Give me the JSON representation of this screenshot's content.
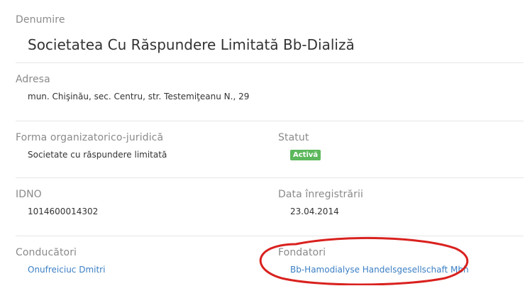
{
  "denumire": {
    "label": "Denumire",
    "value": "Societatea Cu Răspundere Limitată Bb-Dializă"
  },
  "adresa": {
    "label": "Adresa",
    "value": "mun. Chişinău, sec. Centru, str. Testemiţeanu N., 29"
  },
  "forma": {
    "label": "Forma organizatorico-juridică",
    "value": "Societate cu răspundere limitată"
  },
  "statut": {
    "label": "Statut",
    "badge": "Activă",
    "badge_color": "#5cb85c"
  },
  "idno": {
    "label": "IDNO",
    "value": "1014600014302"
  },
  "data_inregistrarii": {
    "label": "Data înregistrării",
    "value": "23.04.2014"
  },
  "conducatori": {
    "label": "Conducători",
    "value": "Onufreiciuc Dmitri"
  },
  "fondatori": {
    "label": "Fondatori",
    "value": "Bb-Hamodialyse Handelsgesellschaft Mbh"
  },
  "colors": {
    "link": "#3b7fc4",
    "label": "#8a8a8a",
    "highlight_oval": "#d9211e"
  }
}
